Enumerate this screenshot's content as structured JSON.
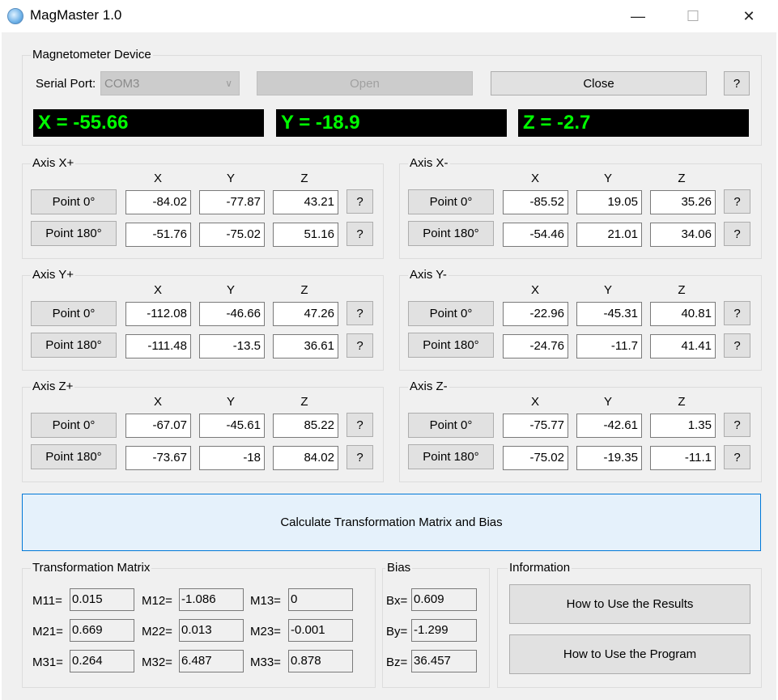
{
  "window": {
    "title": "MagMaster 1.0",
    "minimize_glyph": "—",
    "maximize_glyph": "☐",
    "close_glyph": "✕"
  },
  "device": {
    "group_label": "Magnetometer Device",
    "serial_label": "Serial Port:",
    "port_value": "COM3",
    "open_label": "Open",
    "close_label": "Close",
    "help_label": "?",
    "x_readout": "X = -55.66",
    "y_readout": "Y = -18.9",
    "z_readout": "Z = -2.7"
  },
  "axes": [
    {
      "label": "Axis X+",
      "cols": [
        "X",
        "Y",
        "Z"
      ],
      "p0_label": "Point 0°",
      "p180_label": "Point 180°",
      "help": "?",
      "p0": [
        "-84.02",
        "-77.87",
        "43.21"
      ],
      "p180": [
        "-51.76",
        "-75.02",
        "51.16"
      ]
    },
    {
      "label": "Axis X-",
      "cols": [
        "X",
        "Y",
        "Z"
      ],
      "p0_label": "Point 0°",
      "p180_label": "Point 180°",
      "help": "?",
      "p0": [
        "-85.52",
        "19.05",
        "35.26"
      ],
      "p180": [
        "-54.46",
        "21.01",
        "34.06"
      ]
    },
    {
      "label": "Axis Y+",
      "cols": [
        "X",
        "Y",
        "Z"
      ],
      "p0_label": "Point 0°",
      "p180_label": "Point 180°",
      "help": "?",
      "p0": [
        "-112.08",
        "-46.66",
        "47.26"
      ],
      "p180": [
        "-111.48",
        "-13.5",
        "36.61"
      ]
    },
    {
      "label": "Axis Y-",
      "cols": [
        "X",
        "Y",
        "Z"
      ],
      "p0_label": "Point 0°",
      "p180_label": "Point 180°",
      "help": "?",
      "p0": [
        "-22.96",
        "-45.31",
        "40.81"
      ],
      "p180": [
        "-24.76",
        "-11.7",
        "41.41"
      ]
    },
    {
      "label": "Axis Z+",
      "cols": [
        "X",
        "Y",
        "Z"
      ],
      "p0_label": "Point 0°",
      "p180_label": "Point 180°",
      "help": "?",
      "p0": [
        "-67.07",
        "-45.61",
        "85.22"
      ],
      "p180": [
        "-73.67",
        "-18",
        "84.02"
      ]
    },
    {
      "label": "Axis Z-",
      "cols": [
        "X",
        "Y",
        "Z"
      ],
      "p0_label": "Point 0°",
      "p180_label": "Point 180°",
      "help": "?",
      "p0": [
        "-75.77",
        "-42.61",
        "1.35"
      ],
      "p180": [
        "-75.02",
        "-19.35",
        "-11.1"
      ]
    }
  ],
  "calculate_label": "Calculate Transformation Matrix and Bias",
  "matrix": {
    "group_label": "Transformation Matrix",
    "labels": [
      "M11=",
      "M12=",
      "M13=",
      "M21=",
      "M22=",
      "M23=",
      "M31=",
      "M32=",
      "M33="
    ],
    "values": [
      "0.015",
      "-1.086",
      "0",
      "0.669",
      "0.013",
      "-0.001",
      "0.264",
      "6.487",
      "0.878"
    ]
  },
  "bias": {
    "group_label": "Bias",
    "labels": [
      "Bx=",
      "By=",
      "Bz="
    ],
    "values": [
      "0.609",
      "-1.299",
      "36.457"
    ]
  },
  "info": {
    "group_label": "Information",
    "results_label": "How to Use the Results",
    "program_label": "How to Use the Program"
  }
}
